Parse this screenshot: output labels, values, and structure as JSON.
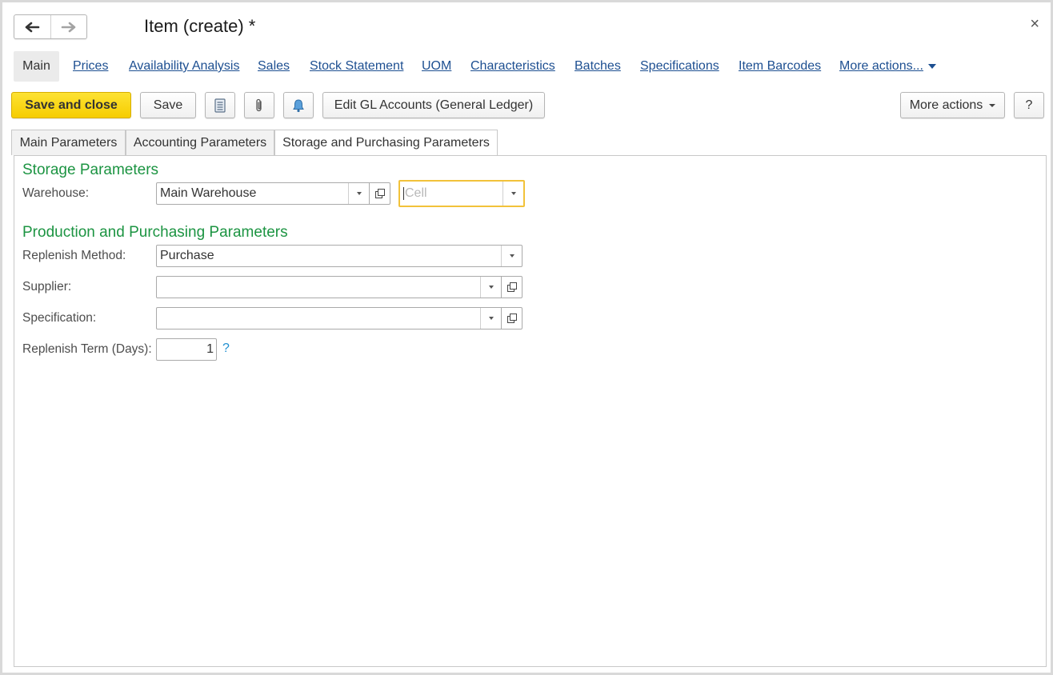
{
  "window": {
    "title": "Item (create) *",
    "close_symbol": "×"
  },
  "navigation": {
    "back_icon": "arrow-left-icon",
    "forward_icon": "arrow-right-icon"
  },
  "links": {
    "main": "Main",
    "items": [
      "Prices",
      "Availability Analysis",
      "Sales",
      "Stock Statement",
      "UOM",
      "Characteristics",
      "Batches",
      "Specifications",
      "Item Barcodes"
    ],
    "more": "More actions..."
  },
  "toolbar": {
    "save_and_close": "Save and close",
    "save": "Save",
    "report_icon": "document-list-icon",
    "attach_icon": "paperclip-icon",
    "reminder_icon": "bell-icon",
    "edit_gl": "Edit GL Accounts (General Ledger)",
    "more_actions": "More actions",
    "help": "?"
  },
  "tabs": [
    {
      "label": "Main Parameters",
      "active": false
    },
    {
      "label": "Accounting Parameters",
      "active": false
    },
    {
      "label": "Storage and Purchasing Parameters",
      "active": true
    }
  ],
  "storage": {
    "title": "Storage Parameters",
    "warehouse_label": "Warehouse:",
    "warehouse_value": "Main Warehouse",
    "cell_placeholder": "Cell"
  },
  "production": {
    "title": "Production and Purchasing Parameters",
    "replenish_method_label": "Replenish Method:",
    "replenish_method_value": "Purchase",
    "supplier_label": "Supplier:",
    "supplier_value": "",
    "specification_label": "Specification:",
    "specification_value": "",
    "replenish_term_label": "Replenish Term (Days):",
    "replenish_term_value": "1",
    "help_symbol": "?"
  },
  "colors": {
    "primary_button": "#f6cd00",
    "section_title": "#1c9442",
    "link": "#1d4f91",
    "focus_border": "#f2c23a",
    "help_icon": "#1f8fd0"
  }
}
